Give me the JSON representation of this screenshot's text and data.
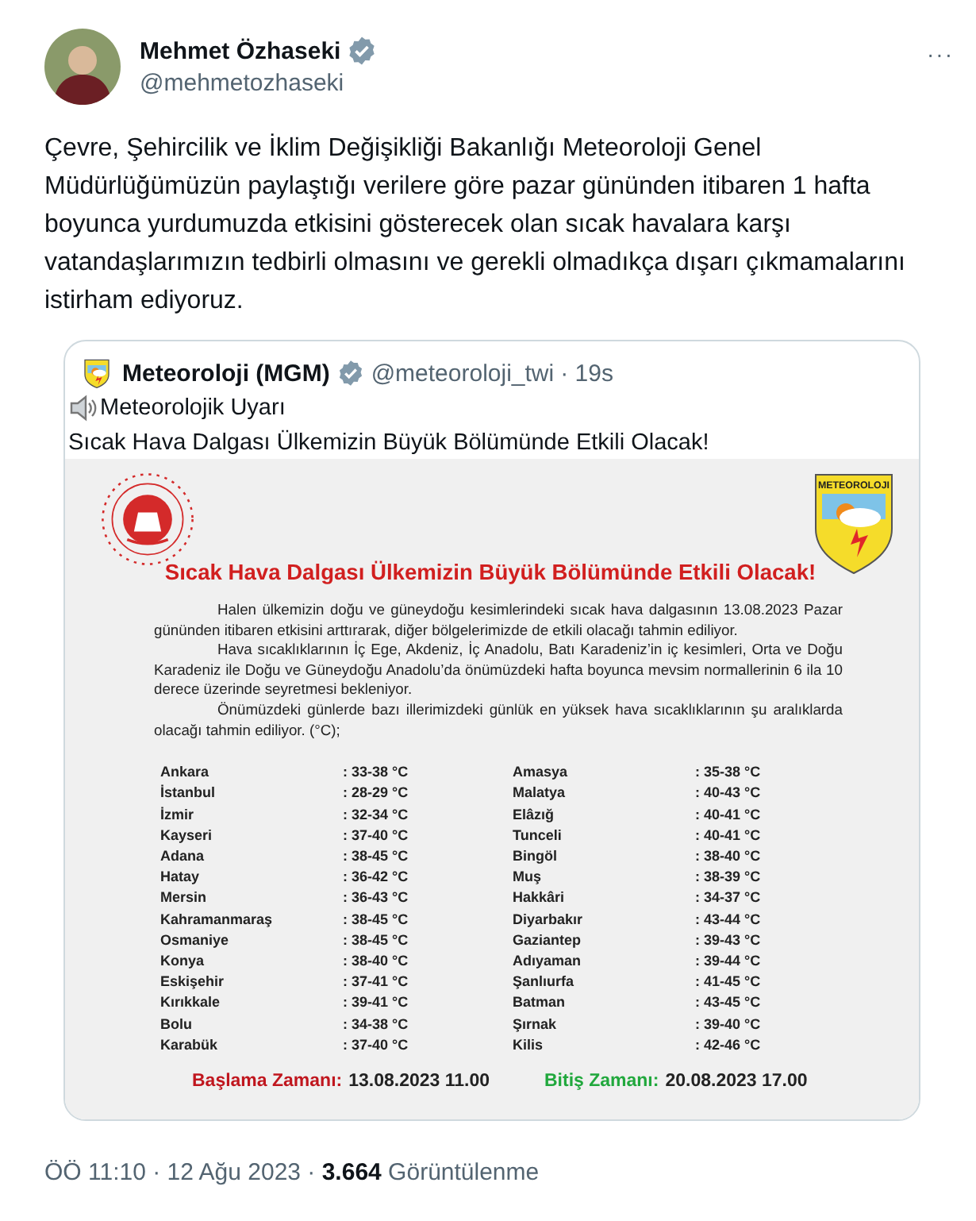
{
  "author": {
    "name": "Mehmet Özhaseki",
    "verified": true,
    "handle": "@mehmetozhaseki",
    "more": "···"
  },
  "text": "Çevre, Şehircilik ve İklim Değişikliği Bakanlığı Meteoroloji Genel Müdürlüğümüzün paylaştığı verilere göre pazar gününden itibaren 1 hafta boyunca yurdumuzda etkisini gösterecek olan sıcak havalara karşı vatandaşlarımızın tedbirli olmasını ve gerekli olmadıkça dışarı çıkmamalarını istirham ediyoruz.",
  "quote": {
    "name": "Meteoroloji (MGM)",
    "verified": true,
    "handle": "@meteoroloji_twi",
    "time": "· 19s",
    "lines": [
      "Meteorolojik Uyarı",
      "Sıcak Hava Dalgası Ülkemizin Büyük Bölümünde Etkili Olacak!"
    ],
    "document": {
      "logo_text": "METEOROLOJI",
      "title": "Sıcak Hava Dalgası Ülkemizin Büyük Bölümünde Etkili Olacak!",
      "paragraphs": [
        "Halen ülkemizin doğu ve güneydoğu kesimlerindeki sıcak hava dalgasının 13.08.2023 Pazar gününden itibaren etkisini arttırarak, diğer bölgelerimizde de etkili olacağı tahmin ediliyor.",
        "Hava sıcaklıklarının İç Ege, Akdeniz, İç Anadolu, Batı Karadeniz’in iç kesimleri, Orta ve Doğu Karadeniz ile Doğu ve Güneydoğu Anadolu’da önümüzdeki hafta boyunca mevsim normallerinin 6 ila 10 derece üzerinde seyretmesi bekleniyor.",
        "Önümüzdeki günlerde bazı illerimizdeki günlük en yüksek hava sıcaklıklarının şu aralıklarda olacağı tahmin ediliyor. (°C);"
      ],
      "columns": [
        [
          {
            "city": "Ankara",
            "range": ": 33-38 °C"
          },
          {
            "city": "İstanbul",
            "range": ": 28-29 °C"
          },
          {
            "city": "İzmir",
            "range": ": 32-34 °C"
          },
          {
            "city": "Kayseri",
            "range": ": 37-40 °C"
          },
          {
            "city": "Adana",
            "range": ": 38-45 °C"
          },
          {
            "city": "Hatay",
            "range": ": 36-42 °C"
          },
          {
            "city": "Mersin",
            "range": ": 36-43 °C"
          },
          {
            "city": "Kahramanmaraş",
            "range": ": 38-45 °C"
          },
          {
            "city": "Osmaniye",
            "range": ": 38-45 °C"
          },
          {
            "city": "Konya",
            "range": ": 38-40 °C"
          },
          {
            "city": "Eskişehir",
            "range": ": 37-41 °C"
          },
          {
            "city": "Kırıkkale",
            "range": ": 39-41 °C"
          },
          {
            "city": "Bolu",
            "range": ": 34-38 °C"
          },
          {
            "city": "Karabük",
            "range": ": 37-40 °C"
          }
        ],
        [
          {
            "city": "Amasya",
            "range": ": 35-38 °C"
          },
          {
            "city": "Malatya",
            "range": ": 40-43 °C"
          },
          {
            "city": "Elâzığ",
            "range": ": 40-41 °C"
          },
          {
            "city": "Tunceli",
            "range": ": 40-41 °C"
          },
          {
            "city": "Bingöl",
            "range": ": 38-40 °C"
          },
          {
            "city": "Muş",
            "range": ": 38-39 °C"
          },
          {
            "city": "Hakkâri",
            "range": ": 34-37 °C"
          },
          {
            "city": "Diyarbakır",
            "range": ": 43-44 °C"
          },
          {
            "city": "Gaziantep",
            "range": ": 39-43 °C"
          },
          {
            "city": "Adıyaman",
            "range": ": 39-44 °C"
          },
          {
            "city": "Şanlıurfa",
            "range": ": 41-45 °C"
          },
          {
            "city": "Batman",
            "range": ": 43-45 °C"
          },
          {
            "city": "Şırnak",
            "range": ": 39-40 °C"
          },
          {
            "city": "Kilis",
            "range": ": 42-46 °C"
          }
        ]
      ],
      "times": [
        {
          "kind": "start",
          "label": "Başlama Zamanı:",
          "value": "13.08.2023 11.00"
        },
        {
          "kind": "end",
          "label": "Bitiş Zamanı:",
          "value": "20.08.2023 17.00"
        }
      ]
    }
  },
  "footer": "ÖÖ 11:10 · 12 Ağu 2023 · **3.664** Görüntülenme"
}
